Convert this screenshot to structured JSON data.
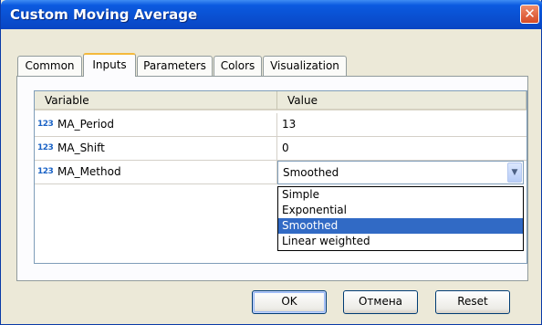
{
  "window": {
    "title": "Custom Moving Average",
    "close_glyph": "✕"
  },
  "tabs": [
    {
      "label": "Common",
      "active": false
    },
    {
      "label": "Inputs",
      "active": true
    },
    {
      "label": "Parameters",
      "active": false
    },
    {
      "label": "Colors",
      "active": false
    },
    {
      "label": "Visualization",
      "active": false
    }
  ],
  "grid": {
    "headers": {
      "variable": "Variable",
      "value": "Value"
    },
    "rows": [
      {
        "icon": "numeric-123-icon",
        "icon_text": "123",
        "variable": "MA_Period",
        "value": "13"
      },
      {
        "icon": "numeric-123-icon",
        "icon_text": "123",
        "variable": "MA_Shift",
        "value": "0"
      },
      {
        "icon": "numeric-123-icon",
        "icon_text": "123",
        "variable": "MA_Method",
        "value": "Smoothed"
      }
    ],
    "dropdown": {
      "options": [
        "Simple",
        "Exponential",
        "Smoothed",
        "Linear weighted"
      ],
      "selected": "Smoothed"
    }
  },
  "buttons": {
    "ok": "OK",
    "cancel": "Отмена",
    "reset": "Reset"
  },
  "colors": {
    "title_bar": "#0a4fd0",
    "selection": "#316ac5",
    "active_tab_accent": "#f4b93c",
    "close_button": "#d64a25"
  }
}
